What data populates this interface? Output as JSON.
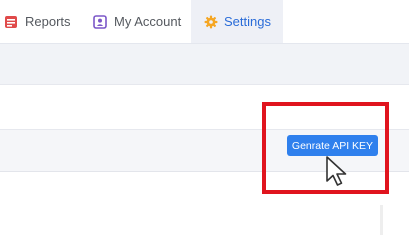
{
  "tabs": {
    "reports": {
      "label": "Reports",
      "icon": "reports-icon",
      "icon_color": "#e04a4a"
    },
    "my_account": {
      "label": "My Account",
      "icon": "account-icon",
      "icon_color": "#7b57c8"
    },
    "settings": {
      "label": "Settings",
      "icon": "gear-icon",
      "icon_color": "#f5a623",
      "active": true
    }
  },
  "api_key": {
    "button_label": "Genrate API KEY",
    "button_color": "#2f80ed"
  },
  "annotation": {
    "highlight_color": "#e0141e"
  }
}
